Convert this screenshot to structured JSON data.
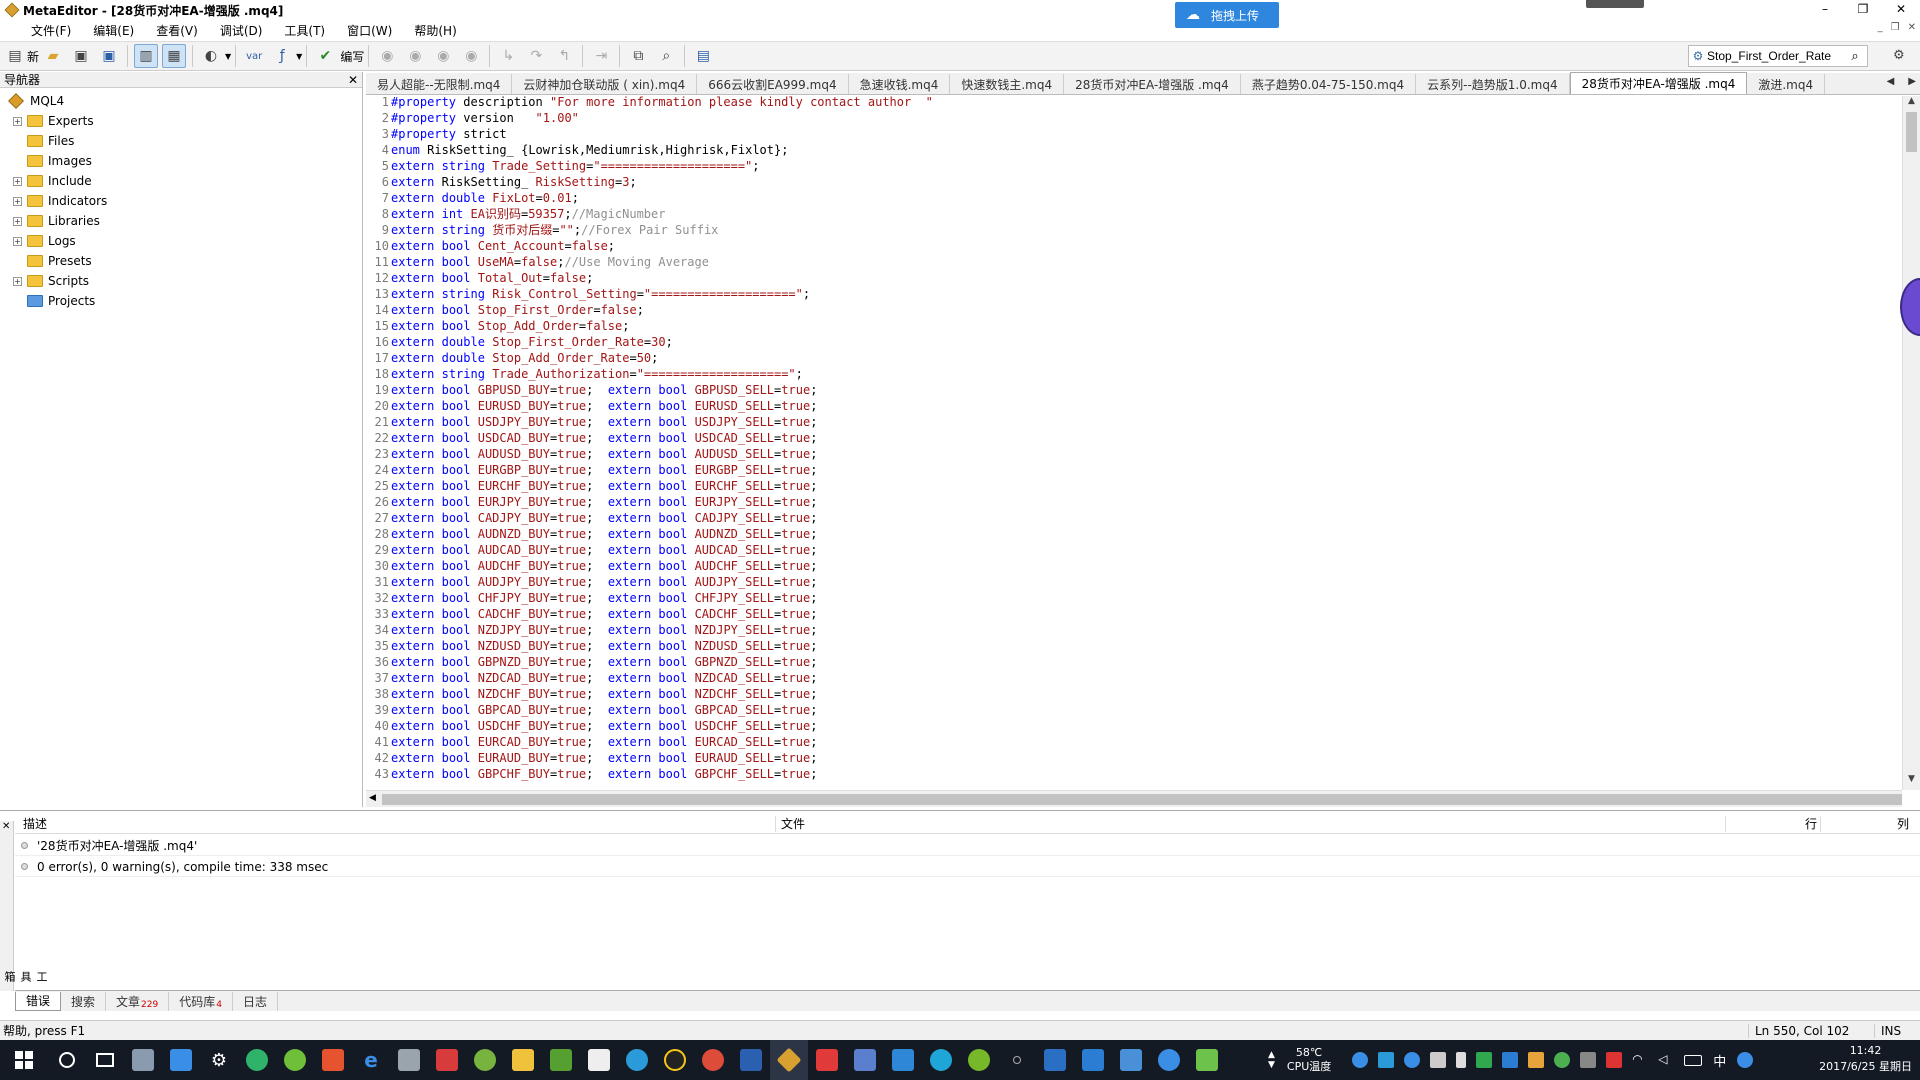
{
  "window": {
    "title": "MetaEditor - [28货币对冲EA-增强版 .mq4]",
    "upload_button": "拖拽上传",
    "controls": [
      "–",
      "❐",
      "✕"
    ]
  },
  "menu": [
    "文件(F)",
    "编辑(E)",
    "查看(V)",
    "调试(D)",
    "工具(T)",
    "窗口(W)",
    "帮助(H)"
  ],
  "toolbar": {
    "new_label": "新",
    "compile_label": "编写",
    "var_label": "var",
    "search_value": "Stop_First_Order_Rate"
  },
  "navigator": {
    "title": "导航器",
    "root": "MQL4",
    "items": [
      {
        "label": "Experts",
        "expandable": true
      },
      {
        "label": "Files",
        "expandable": false
      },
      {
        "label": "Images",
        "expandable": false
      },
      {
        "label": "Include",
        "expandable": true
      },
      {
        "label": "Indicators",
        "expandable": true
      },
      {
        "label": "Libraries",
        "expandable": true
      },
      {
        "label": "Logs",
        "expandable": true
      },
      {
        "label": "Presets",
        "expandable": false
      },
      {
        "label": "Scripts",
        "expandable": true
      },
      {
        "label": "Projects",
        "expandable": false
      }
    ]
  },
  "tabs": [
    {
      "label": "易人超能--无限制.mq4",
      "active": false
    },
    {
      "label": "云财神加仓联动版 ( xin).mq4",
      "active": false
    },
    {
      "label": "666云收割EA999.mq4",
      "active": false
    },
    {
      "label": "急速收钱.mq4",
      "active": false
    },
    {
      "label": "快速数钱主.mq4",
      "active": false
    },
    {
      "label": "28货币对冲EA-增强版 .mq4",
      "active": false
    },
    {
      "label": "燕子趋势0.04-75-150.mq4",
      "active": false
    },
    {
      "label": "云系列--趋势版1.0.mq4",
      "active": false
    },
    {
      "label": "28货币对冲EA-增强版 .mq4",
      "active": true
    },
    {
      "label": "激进.mq4",
      "active": false
    }
  ],
  "code_lines": [
    "#property description \"For more information please kindly contact author  \"",
    "#property version   \"1.00\"",
    "#property strict",
    "enum RiskSetting_ {Lowrisk,Mediumrisk,Highrisk,Fixlot};",
    "extern string Trade_Setting=\"====================\";",
    "extern RiskSetting_ RiskSetting=3;",
    "extern double FixLot=0.01;",
    "extern int EA识别码=59357;//MagicNumber",
    "extern string 货币对后缀=\"\";//Forex Pair Suffix",
    "extern bool Cent_Account=false;",
    "extern bool UseMA=false;//Use Moving Average",
    "extern bool Total_Out=false;",
    "extern string Risk_Control_Setting=\"====================\";",
    "extern bool Stop_First_Order=false;",
    "extern bool Stop_Add_Order=false;",
    "extern double Stop_First_Order_Rate=30;",
    "extern double Stop_Add_Order_Rate=50;",
    "extern string Trade_Authorization=\"====================\";",
    "extern bool GBPUSD_BUY=true;  extern bool GBPUSD_SELL=true;",
    "extern bool EURUSD_BUY=true;  extern bool EURUSD_SELL=true;",
    "extern bool USDJPY_BUY=true;  extern bool USDJPY_SELL=true;",
    "extern bool USDCAD_BUY=true;  extern bool USDCAD_SELL=true;",
    "extern bool AUDUSD_BUY=true;  extern bool AUDUSD_SELL=true;",
    "extern bool EURGBP_BUY=true;  extern bool EURGBP_SELL=true;",
    "extern bool EURCHF_BUY=true;  extern bool EURCHF_SELL=true;",
    "extern bool EURJPY_BUY=true;  extern bool EURJPY_SELL=true;",
    "extern bool CADJPY_BUY=true;  extern bool CADJPY_SELL=true;",
    "extern bool AUDNZD_BUY=true;  extern bool AUDNZD_SELL=true;",
    "extern bool AUDCAD_BUY=true;  extern bool AUDCAD_SELL=true;",
    "extern bool AUDCHF_BUY=true;  extern bool AUDCHF_SELL=true;",
    "extern bool AUDJPY_BUY=true;  extern bool AUDJPY_SELL=true;",
    "extern bool CHFJPY_BUY=true;  extern bool CHFJPY_SELL=true;",
    "extern bool CADCHF_BUY=true;  extern bool CADCHF_SELL=true;",
    "extern bool NZDJPY_BUY=true;  extern bool NZDJPY_SELL=true;",
    "extern bool NZDUSD_BUY=true;  extern bool NZDUSD_SELL=true;",
    "extern bool GBPNZD_BUY=true;  extern bool GBPNZD_SELL=true;",
    "extern bool NZDCAD_BUY=true;  extern bool NZDCAD_SELL=true;",
    "extern bool NZDCHF_BUY=true;  extern bool NZDCHF_SELL=true;",
    "extern bool GBPCAD_BUY=true;  extern bool GBPCAD_SELL=true;",
    "extern bool USDCHF_BUY=true;  extern bool USDCHF_SELL=true;",
    "extern bool EURCAD_BUY=true;  extern bool EURCAD_SELL=true;",
    "extern bool EURAUD_BUY=true;  extern bool EURAUD_SELL=true;",
    "extern bool GBPCHF_BUY=true;  extern bool GBPCHF_SELL=true;"
  ],
  "toolbox": {
    "side_label": "工具箱",
    "columns": {
      "desc": "描述",
      "file": "文件",
      "line": "行",
      "col": "列"
    },
    "messages": [
      "'28货币对冲EA-增强版 .mq4'",
      "0 error(s), 0 warning(s), compile time: 338 msec"
    ],
    "tabs": [
      {
        "label": "错误",
        "badge": "",
        "active": true
      },
      {
        "label": "搜索",
        "badge": "",
        "active": false
      },
      {
        "label": "文章",
        "badge": "229",
        "active": false
      },
      {
        "label": "代码库",
        "badge": "4",
        "active": false
      },
      {
        "label": "日志",
        "badge": "",
        "active": false
      }
    ]
  },
  "statusbar": {
    "help": "帮助, press F1",
    "position": "Ln 550, Col 102",
    "mode": "INS"
  },
  "taskbar": {
    "cpu_temp": "58℃",
    "cpu_label": "CPU温度",
    "ime": "中",
    "time": "11:42",
    "date": "2017/6/25 星期日"
  },
  "colors": {
    "keyword": "#0000ff",
    "value": "#a31515",
    "comment": "#909090",
    "taskbar": "#141a24"
  }
}
